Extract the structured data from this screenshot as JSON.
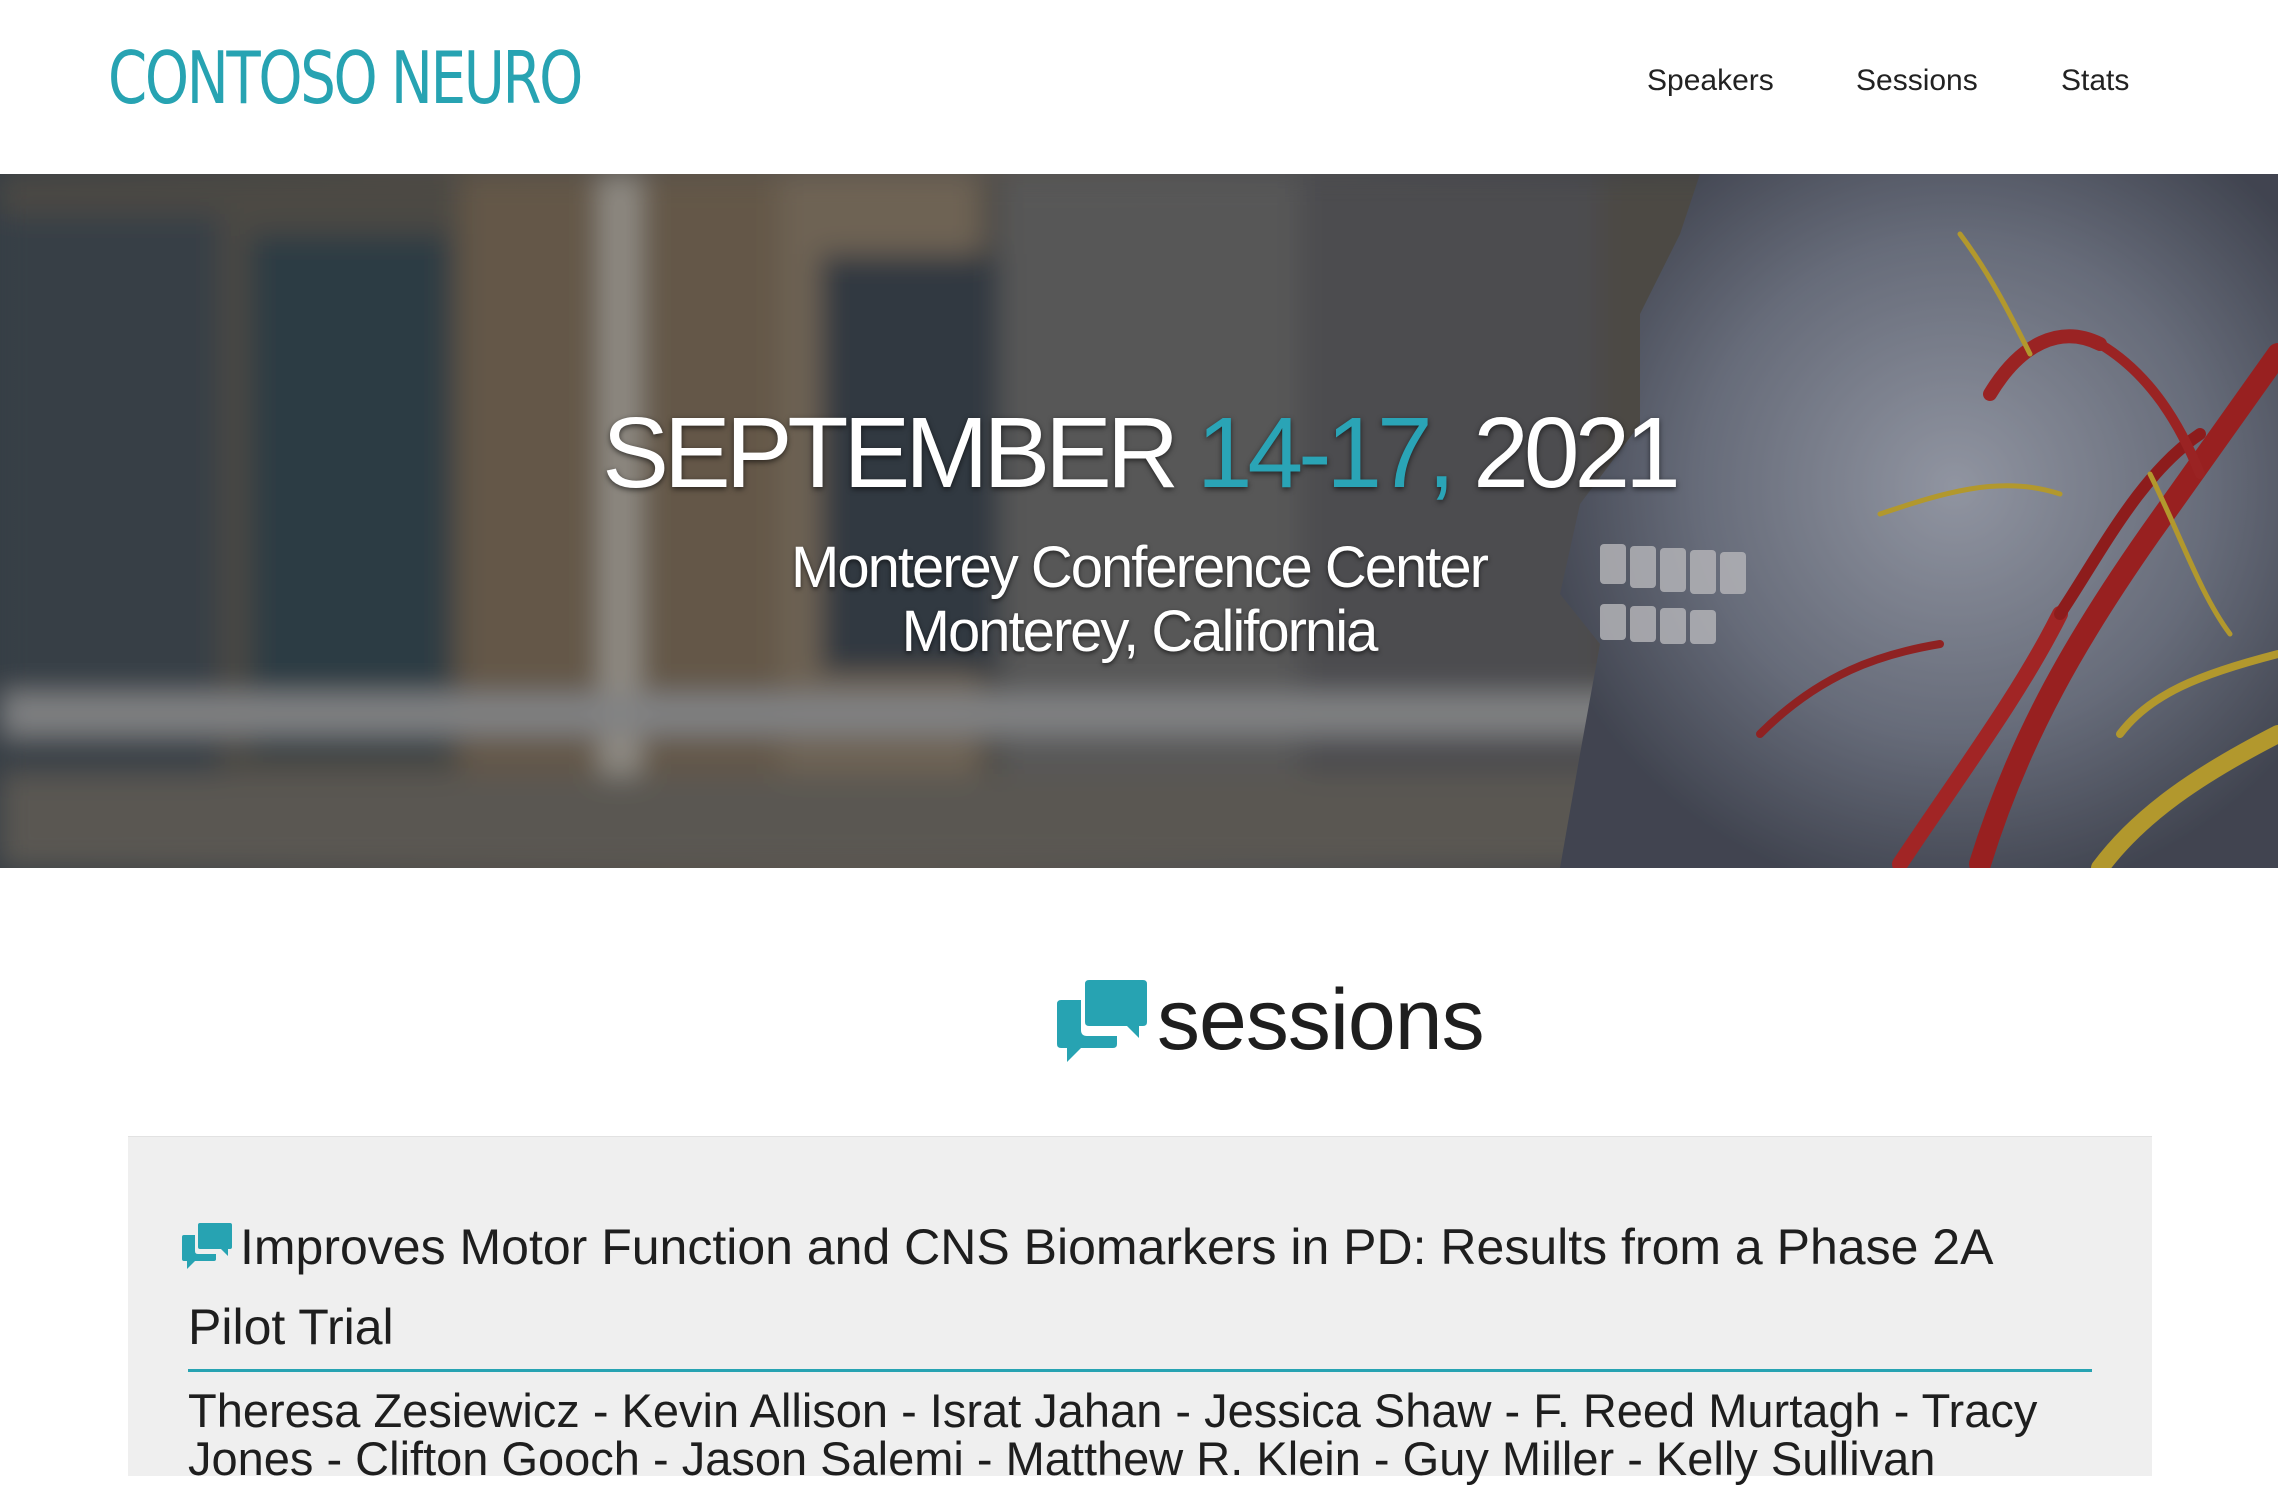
{
  "header": {
    "logo": "CONTOSO NEURO",
    "nav": {
      "speakers": "Speakers",
      "sessions": "Sessions",
      "stats": "Stats"
    }
  },
  "hero": {
    "month": "SEPTEMBER",
    "days": "14-17,",
    "year": "2021",
    "venue_line1": "Monterey Conference Center",
    "venue_line2": "Monterey, California"
  },
  "sessions": {
    "heading": "sessions",
    "items": [
      {
        "title": "Improves Motor Function and CNS Biomarkers in PD: Results from a Phase 2A Pilot Trial",
        "authors": "Theresa Zesiewicz - Kevin Allison - Israt Jahan - Jessica Shaw - F. Reed Murtagh - Tracy Jones - Clifton Gooch - Jason Salemi - Matthew R. Klein - Guy Miller - Kelly Sullivan"
      }
    ]
  },
  "colors": {
    "accent": "#27a3b2",
    "text": "#1e1e1e",
    "card_background": "#efefef"
  },
  "icons": {
    "sessions_heading_icon": "speech-bubbles-icon",
    "session_item_icon": "speech-bubbles-icon"
  }
}
